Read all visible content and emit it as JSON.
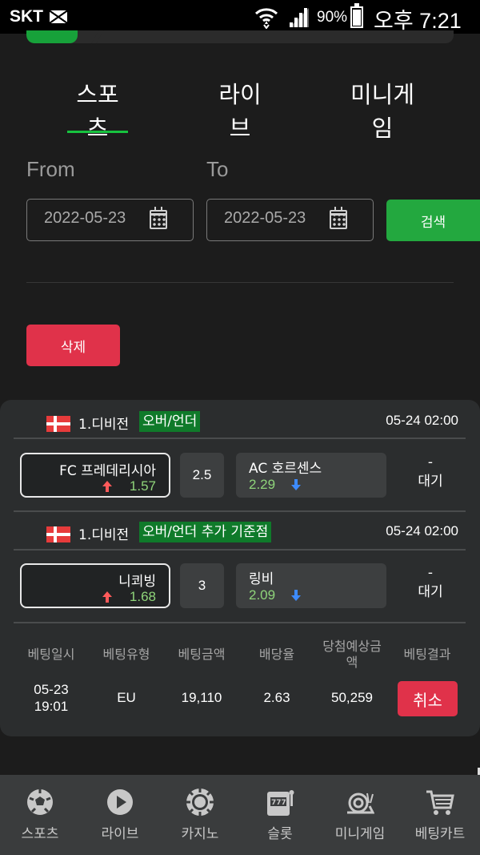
{
  "status_bar": {
    "carrier": "SKT",
    "battery_text": "90%",
    "time": "오후 7:21"
  },
  "colors": {
    "accent_green": "#17c23f",
    "button_green": "#23a83f",
    "danger_red": "#e0324a",
    "odds_green": "#8fd47a",
    "arrow_up_red": "#ff5a5a",
    "arrow_down_blue": "#3d8bff"
  },
  "progress": {
    "fill_fraction": 0.12
  },
  "tabs": [
    {
      "label": "스포츠",
      "active": true
    },
    {
      "label": "라이브",
      "active": false
    },
    {
      "label": "미니게임",
      "active": false
    }
  ],
  "filter": {
    "from_label": "From",
    "to_label": "To",
    "from_date": "2022-05-23",
    "to_date": "2022-05-23",
    "search_label": "검색",
    "delete_label": "삭제"
  },
  "bets": [
    {
      "league": "1.디비전",
      "market": "오버/언더",
      "time": "05-24 02:00",
      "home_team": "FC 프레데리시아",
      "home_odds": "1.57",
      "line": "2.5",
      "away_team": "AC 호르센스",
      "away_odds": "2.29",
      "status_dash": "-",
      "status": "대기"
    },
    {
      "league": "1.디비전",
      "market": "오버/언더 추가 기준점",
      "time": "05-24 02:00",
      "home_team": "니쾨빙",
      "home_odds": "1.68",
      "line": "3",
      "away_team": "링비",
      "away_odds": "2.09",
      "status_dash": "-",
      "status": "대기"
    }
  ],
  "summary": {
    "headers": [
      "베팅일시",
      "베팅유형",
      "베팅금액",
      "배당율",
      "당첨예상금액",
      "베팅결과"
    ],
    "date": "05-23",
    "time": "19:01",
    "type": "EU",
    "amount": "19,110",
    "rate": "2.63",
    "expected": "50,259",
    "result_button": "취소"
  },
  "bottom_nav": [
    {
      "label": "스포츠",
      "icon": "soccer-ball-icon"
    },
    {
      "label": "라이브",
      "icon": "play-icon"
    },
    {
      "label": "카지노",
      "icon": "casino-chip-icon"
    },
    {
      "label": "슬롯",
      "icon": "slot-machine-icon"
    },
    {
      "label": "미니게임",
      "icon": "snail-icon"
    },
    {
      "label": "베팅카트",
      "icon": "shopping-cart-icon"
    }
  ]
}
